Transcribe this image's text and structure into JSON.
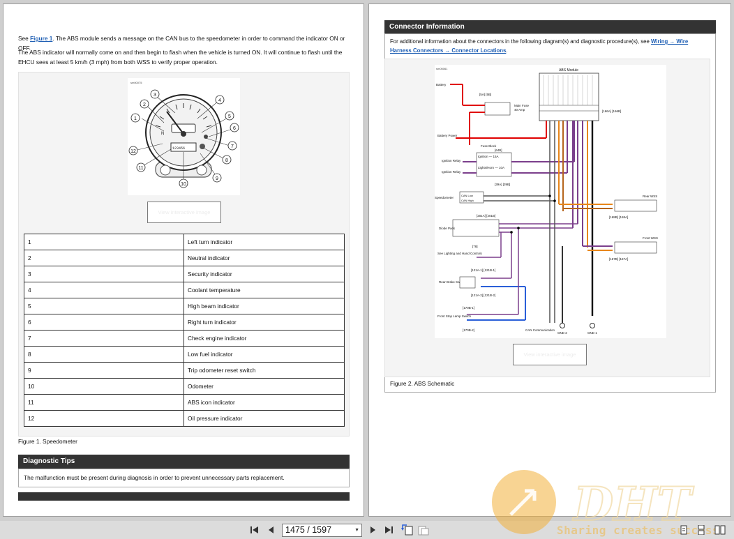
{
  "left_page": {
    "para1_prefix": "See ",
    "para1_link": "Figure 1",
    "para1_rest": ". The ABS module sends a message on the CAN bus to the speedometer in order to command the indicator ON or OFF.",
    "para2": "The ABS indicator will normally come on and then begin to flash when the vehicle is turned ON. It will continue to flash until the EHCU sees at least 5 km/h (3 mph) from both WSS to verify proper operation.",
    "figure_id": "sm00075",
    "view_button": "View interactive image",
    "callouts": [
      "1",
      "2",
      "3",
      "4",
      "5",
      "6",
      "7",
      "8",
      "9",
      "10",
      "11",
      "12"
    ],
    "legend": [
      {
        "num": "1",
        "label": "Left turn indicator"
      },
      {
        "num": "2",
        "label": "Neutral indicator"
      },
      {
        "num": "3",
        "label": "Security indicator"
      },
      {
        "num": "4",
        "label": "Coolant temperature"
      },
      {
        "num": "5",
        "label": "High beam indicator"
      },
      {
        "num": "6",
        "label": "Right turn indicator"
      },
      {
        "num": "7",
        "label": "Check engine indicator"
      },
      {
        "num": "8",
        "label": "Low fuel indicator"
      },
      {
        "num": "9",
        "label": "Trip odometer reset switch"
      },
      {
        "num": "10",
        "label": "Odometer"
      },
      {
        "num": "11",
        "label": "ABS icon indicator"
      },
      {
        "num": "12",
        "label": "Oil pressure indicator"
      }
    ],
    "caption": "Figure 1. Speedometer",
    "tips_title": "Diagnostic Tips",
    "tips_text": "The malfunction must be present during diagnosis in order to prevent unnecessary parts replacement."
  },
  "right_page": {
    "section_title": "Connector Information",
    "intro_prefix": "For additional information about the connectors in the following diagram(s) and diagnostic procedure(s), see ",
    "intro_link": "Wiring → Wire Harness Connectors → Connector Locations",
    "intro_suffix": ".",
    "schematic": {
      "id": "sm05061",
      "abs_module": "ABS Module",
      "battery": "Battery",
      "main_fuse": "Main Fuse",
      "main_fuse_amp": "40 Amp",
      "fuse_ref": "[5A] [5B]",
      "battery_power": "Battery Power",
      "fuse_block": "Fuse Block",
      "fuse_block_ref": "[64B]",
      "ignition_relay": "Ignition Relay",
      "ignition_fuse": "Ignition — 15A",
      "lights_fuse": "Lights/Horn — 10A",
      "speedometer": "Speedometer",
      "speedo_ref": "[39A] [39B]",
      "can_low": "CAN Low",
      "can_high": "CAN High",
      "diode_pack": "Diode Pack",
      "diode_ref": "[201A] [201B]",
      "lighting_controls": "See Lighting and Hand Controls",
      "lighting_ref": "[78]",
      "rear_brake": "Rear Brake Switch",
      "rear_brake_ref": "[121A-1] [121B-1]",
      "rear_brake_ref2": "[121A-2] [121B-2]",
      "front_stop": "Front Stop Lamp Switch",
      "front_stop_ref": "[170B-1]",
      "front_stop_ref2": "[170B-2]",
      "rear_wss": "Rear WSS",
      "rear_wss_ref": "[168B] [168A]",
      "front_wss": "Front WSS",
      "front_wss_ref": "[167B] [167A]",
      "abs_ref": "[166A] [166B]",
      "can_comm": "CAN Communication",
      "gnd1": "GND 1",
      "gnd2": "GND 2"
    },
    "view_button": "View interactive image",
    "caption": "Figure 2. ABS Schematic"
  },
  "toolbar": {
    "page_indicator": "1475 / 1597",
    "watermark_brand": "DHT",
    "watermark_slogan": "Sharing creates success"
  },
  "colors": {
    "section_header": "#333333",
    "link": "#1f5fb4",
    "wire_red": "#e00000",
    "wire_purple": "#7b3f8c",
    "wire_orange": "#e8861a",
    "wire_blue": "#2a5fd8",
    "wire_black": "#000000",
    "watermark": "#f2b13a"
  }
}
